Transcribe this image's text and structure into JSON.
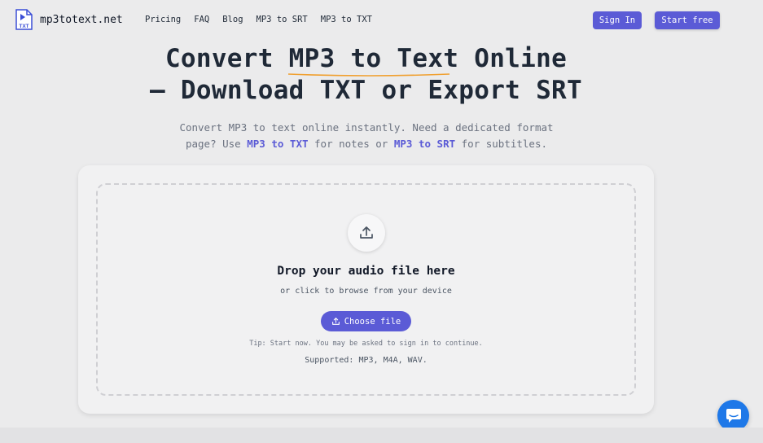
{
  "brand": {
    "name": "mp3totext.net",
    "logo_text": "TXT",
    "logo_icon": "play-file-icon"
  },
  "nav": {
    "items": [
      {
        "label": "Pricing"
      },
      {
        "label": "FAQ"
      },
      {
        "label": "Blog"
      },
      {
        "label": "MP3 to SRT"
      },
      {
        "label": "MP3 to TXT"
      }
    ]
  },
  "header": {
    "signin_label": "Sign In",
    "start_label": "Start free"
  },
  "hero": {
    "title_part1": "Convert ",
    "title_highlight": "MP3 to Text",
    "title_part2": " Online",
    "title_line2": "— Download TXT or Export SRT",
    "subtitle_line1": "Convert MP3 to text online instantly. Need a dedicated format",
    "subtitle_pre": "page? Use ",
    "subtitle_link1": "MP3 to TXT",
    "subtitle_mid": " for notes or ",
    "subtitle_link2": "MP3 to SRT",
    "subtitle_post": " for subtitles."
  },
  "upload": {
    "icon": "upload-icon",
    "title": "Drop your audio file here",
    "subtitle": "or click to browse from your device",
    "button_label": "Choose file",
    "tip": "Tip: Start now. You may be asked to sign in to continue.",
    "supported": "Supported: MP3, M4A, WAV."
  },
  "chat": {
    "icon": "chat-icon"
  },
  "colors": {
    "accent": "#5b5bd6",
    "highlight_underline": "#f0a030",
    "chat": "#1e78e8",
    "background": "#ebebec"
  }
}
